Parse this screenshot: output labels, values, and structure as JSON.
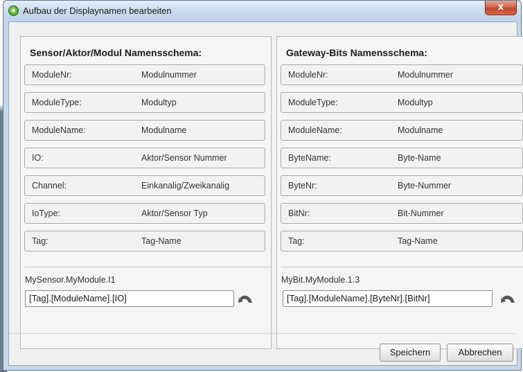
{
  "window": {
    "title": "Aufbau der Displaynamen bearbeiten",
    "close_label": "x"
  },
  "left_panel": {
    "heading": "Sensor/Aktor/Modul Namensschema:",
    "fields": [
      {
        "key": "ModuleNr:",
        "desc": "Modulnummer"
      },
      {
        "key": "ModuleType:",
        "desc": "Modultyp"
      },
      {
        "key": "ModuleName:",
        "desc": "Modulname"
      },
      {
        "key": "IO:",
        "desc": "Aktor/Sensor Nummer"
      },
      {
        "key": "Channel:",
        "desc": "Einkanalig/Zweikanalig"
      },
      {
        "key": "IoType:",
        "desc": "Aktor/Sensor Typ"
      },
      {
        "key": "Tag:",
        "desc": "Tag-Name"
      }
    ],
    "preview": "MySensor.MyModule.I1",
    "pattern": "[Tag].[ModuleName].[IO]"
  },
  "right_panel": {
    "heading": "Gateway-Bits Namensschema:",
    "fields": [
      {
        "key": "ModuleNr:",
        "desc": "Modulnummer"
      },
      {
        "key": "ModuleType:",
        "desc": "Modultyp"
      },
      {
        "key": "ModuleName:",
        "desc": "Modulname"
      },
      {
        "key": "ByteName:",
        "desc": "Byte-Name"
      },
      {
        "key": "ByteNr:",
        "desc": "Byte-Nummer"
      },
      {
        "key": "BitNr:",
        "desc": "Bit-Nummer"
      },
      {
        "key": "Tag:",
        "desc": "Tag-Name"
      }
    ],
    "preview": "MyBit.MyModule.1.3",
    "pattern": "[Tag].[ModuleName].[ByteNr].[BitNr]"
  },
  "footer": {
    "save_label": "Speichern",
    "cancel_label": "Abbrechen"
  },
  "colors": {
    "title_gradient_top": "#e3eefa",
    "close_red": "#c0442a",
    "panel_bg": "#f5f5f5",
    "reset_icon": "#555555"
  },
  "icons": {
    "app": "app-logo-icon",
    "reset": "reset-icon"
  }
}
